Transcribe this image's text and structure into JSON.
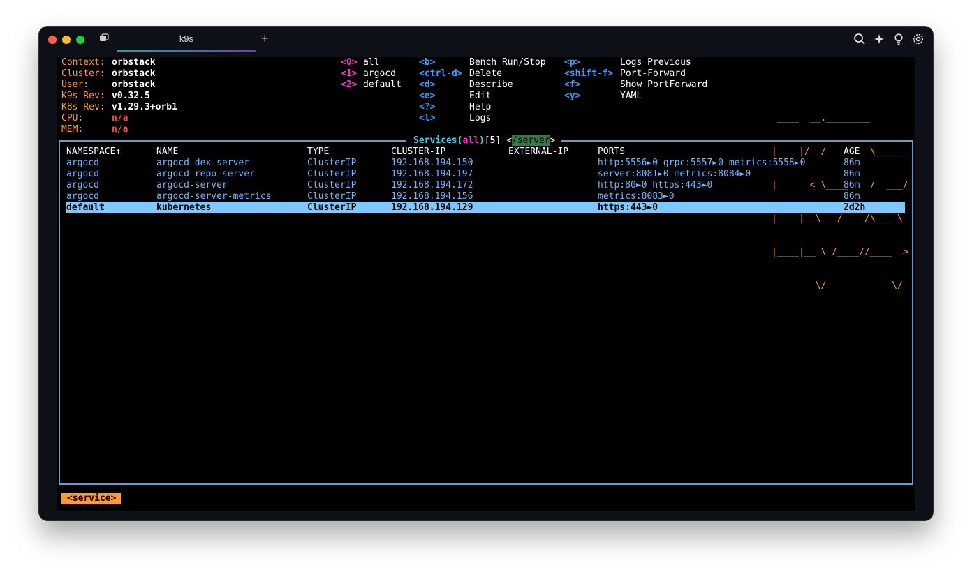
{
  "window": {
    "tab_title": "k9s"
  },
  "header": {
    "info": [
      {
        "label": "Context:",
        "value": "orbstack"
      },
      {
        "label": "Cluster:",
        "value": "orbstack"
      },
      {
        "label": "User:",
        "value": "orbstack"
      },
      {
        "label": "K9s Rev:",
        "value": "v0.32.5"
      },
      {
        "label": "K8s Rev:",
        "value": "v1.29.3+orb1"
      },
      {
        "label": "CPU:",
        "value": "n/a"
      },
      {
        "label": "MEM:",
        "value": "n/a"
      }
    ],
    "namespaces": [
      {
        "key": "<0>",
        "name": "all"
      },
      {
        "key": "<1>",
        "name": "argocd"
      },
      {
        "key": "<2>",
        "name": "default"
      }
    ],
    "shortcuts_col1": [
      {
        "key": "<b>",
        "action": "Bench Run/Stop"
      },
      {
        "key": "<ctrl-d>",
        "action": "Delete"
      },
      {
        "key": "<d>",
        "action": "Describe"
      },
      {
        "key": "<e>",
        "action": "Edit"
      },
      {
        "key": "<?>",
        "action": "Help"
      },
      {
        "key": "<l>",
        "action": "Logs"
      }
    ],
    "shortcuts_col2": [
      {
        "key": "<p>",
        "action": "Logs Previous"
      },
      {
        "key": "<shift-f>",
        "action": "Port-Forward"
      },
      {
        "key": "<f>",
        "action": "Show PortForward"
      },
      {
        "key": "<y>",
        "action": "YAML"
      }
    ],
    "logo": [
      " ____  __.________       ",
      "|    |/ _/   __   \\______",
      "|      < \\____    /  ___/",
      "|    |  \\   /    /\\___ \\ ",
      "|____|__ \\ /____//____  >",
      "        \\/            \\/ "
    ]
  },
  "table": {
    "title_resource": "Services",
    "title_ns": "all",
    "title_count": "5",
    "filter": "/server",
    "columns": [
      "NAMESPACE↑",
      "NAME",
      "TYPE",
      "CLUSTER-IP",
      "EXTERNAL-IP",
      "PORTS",
      "AGE"
    ],
    "rows": [
      {
        "namespace": "argocd",
        "name": "argocd-dex-server",
        "type": "ClusterIP",
        "cluster_ip": "192.168.194.150",
        "external_ip": "",
        "ports": "http:5556►0 grpc:5557►0 metrics:5558►0",
        "age": "86m"
      },
      {
        "namespace": "argocd",
        "name": "argocd-repo-server",
        "type": "ClusterIP",
        "cluster_ip": "192.168.194.197",
        "external_ip": "",
        "ports": "server:8081►0 metrics:8084►0",
        "age": "86m"
      },
      {
        "namespace": "argocd",
        "name": "argocd-server",
        "type": "ClusterIP",
        "cluster_ip": "192.168.194.172",
        "external_ip": "",
        "ports": "http:80►0 https:443►0",
        "age": "86m"
      },
      {
        "namespace": "argocd",
        "name": "argocd-server-metrics",
        "type": "ClusterIP",
        "cluster_ip": "192.168.194.156",
        "external_ip": "",
        "ports": "metrics:8083►0",
        "age": "86m"
      },
      {
        "namespace": "default",
        "name": "kubernetes",
        "type": "ClusterIP",
        "cluster_ip": "192.168.194.129",
        "external_ip": "",
        "ports": "https:443►0",
        "age": "2d2h",
        "selected": true
      }
    ]
  },
  "footer": {
    "breadcrumb": "<service>"
  },
  "colors": {
    "accent_orange": "#ff9a2e",
    "selection": "#7ec8ff",
    "frame": "#5ba0d8"
  }
}
